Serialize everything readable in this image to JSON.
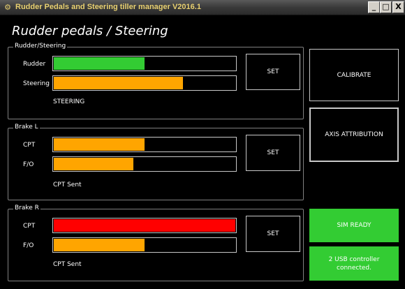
{
  "window": {
    "title": "Rudder Pedals and Steering tiller manager V2016.1",
    "minimize_label": "_",
    "maximize_label": "□",
    "close_label": "X"
  },
  "colors": {
    "green": "#33cc33",
    "orange": "#ffa500",
    "red": "#ff0000"
  },
  "page_title": "Rudder pedals / Steering",
  "groups": {
    "rudder_steering": {
      "title": "Rudder/Steering",
      "rows": [
        {
          "label": "Rudder",
          "fill_percent": 50,
          "color": "#33cc33"
        },
        {
          "label": "Steering",
          "fill_percent": 71,
          "color": "#ffa500"
        }
      ],
      "set_label": "SET",
      "status": "STEERING"
    },
    "brake_l": {
      "title": "Brake L",
      "rows": [
        {
          "label": "CPT",
          "fill_percent": 50,
          "color": "#ffa500"
        },
        {
          "label": "F/O",
          "fill_percent": 44,
          "color": "#ffa500"
        }
      ],
      "set_label": "SET",
      "status": "CPT Sent"
    },
    "brake_r": {
      "title": "Brake R",
      "rows": [
        {
          "label": "CPT",
          "fill_percent": 100,
          "color": "#ff0000"
        },
        {
          "label": "F/O",
          "fill_percent": 50,
          "color": "#ffa500"
        }
      ],
      "set_label": "SET",
      "status": "CPT Sent"
    }
  },
  "side": {
    "calibrate_label": "CALIBRATE",
    "axis_label": "AXIS ATTRIBUTION",
    "sim_ready_label": "SIM READY",
    "usb_status": "2 USB controller connected."
  }
}
